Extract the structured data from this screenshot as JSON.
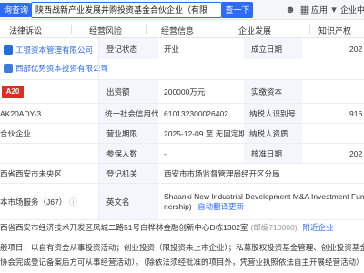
{
  "header": {
    "brand_label": "询查询",
    "search_value": "陕西战新产业发展井购投资基金合伙企业（有限",
    "search_button": "查一下",
    "app_label": "应用",
    "enterprise_center": "企业中"
  },
  "nav": {
    "tabs": [
      "法律诉讼",
      "经营风险",
      "经营信息",
      "企业发展",
      "知识产权"
    ]
  },
  "rows": {
    "partner1": "工银资本管理有限公司",
    "partner2": "西部优势资本投资有限公司",
    "logo_text": "A20",
    "reg_status_label": "登记状态",
    "reg_status_value": "开业",
    "established_label": "成立日期",
    "established_value": "202",
    "capital_label": "出资额",
    "capital_value": "200000万元",
    "paid_capital_label": "实缴资本",
    "credit_label": "统一社会信用代码",
    "credit_value_left": "AK20ADY-3",
    "credit_value": "61013230002640​2",
    "taxpayer_id_label": "纳税人识别号",
    "taxpayer_id_value": "916",
    "type_value_left": "合伙企业",
    "term_label": "营业期限",
    "term_value": "2025-12-09 至 无固定期限",
    "taxpayer_qual_label": "纳税人资质",
    "insured_label": "参保人数",
    "insured_value": "-",
    "approved_label": "核准日期",
    "approved_value": "202",
    "region_value": "西省西安市未央区",
    "authority_label": "登记机关",
    "authority_value": "西安市市场监督管理局经开区分局",
    "industry_value": "本市场服务（J67）",
    "english_label": "英文名",
    "english_value1": "Shaanxi New Industrial Development M&A Investment Fund",
    "english_value2": "nership)",
    "english_link": "自动翻译更新",
    "address_value": "西省西安市经济技术开发区凤城二路51号白桦林金融创新中心D栋1302室",
    "postcode": "(邮编710000)",
    "nearby_link": "附近企业",
    "scope_line1": "般项目：以自有资金从事投资活动；创业投资（限投资未上市企业）；私募股权投资基金管理、创业投资基金管理服",
    "scope_line2": "协会完成登记备案后方可从事经营活动）。（除依法须经批准的项目外，凭营业执照依法自主开展经营活动）"
  }
}
